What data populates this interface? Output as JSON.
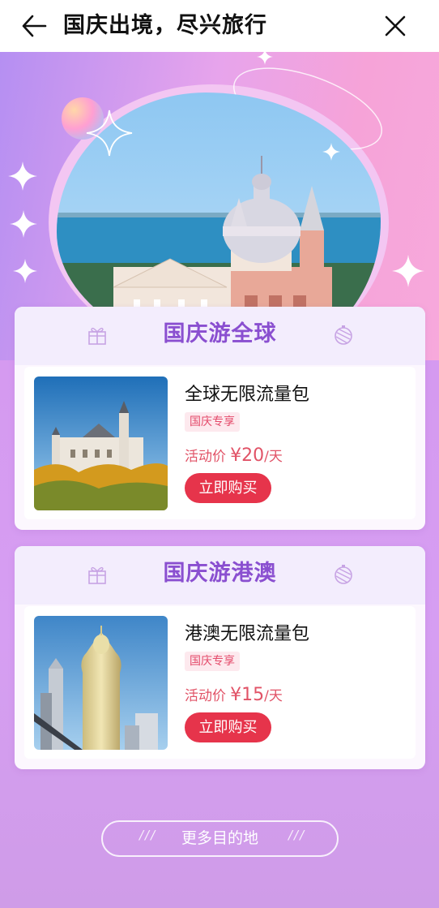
{
  "header": {
    "title": "国庆出境，尽兴旅行",
    "back_icon": "arrow-left-icon",
    "close_icon": "close-icon"
  },
  "hero": {
    "image": "venice-church-photo"
  },
  "sections": [
    {
      "title": "国庆游全球",
      "product": {
        "name": "全球无限流量包",
        "tag": "国庆专享",
        "price_label": "活动价",
        "price": "¥20",
        "unit": "/天",
        "button": "立即购买",
        "image": "castle-photo"
      }
    },
    {
      "title": "国庆游港澳",
      "product": {
        "name": "港澳无限流量包",
        "tag": "国庆专享",
        "price_label": "活动价",
        "price": "¥15",
        "unit": "/天",
        "button": "立即购买",
        "image": "macau-skyline-photo"
      }
    }
  ],
  "footer": {
    "more_label": "更多目的地",
    "deco": "///"
  },
  "colors": {
    "accent_purple": "#8a4fd0",
    "buy_red": "#e6344b",
    "price_red": "#e15367"
  }
}
